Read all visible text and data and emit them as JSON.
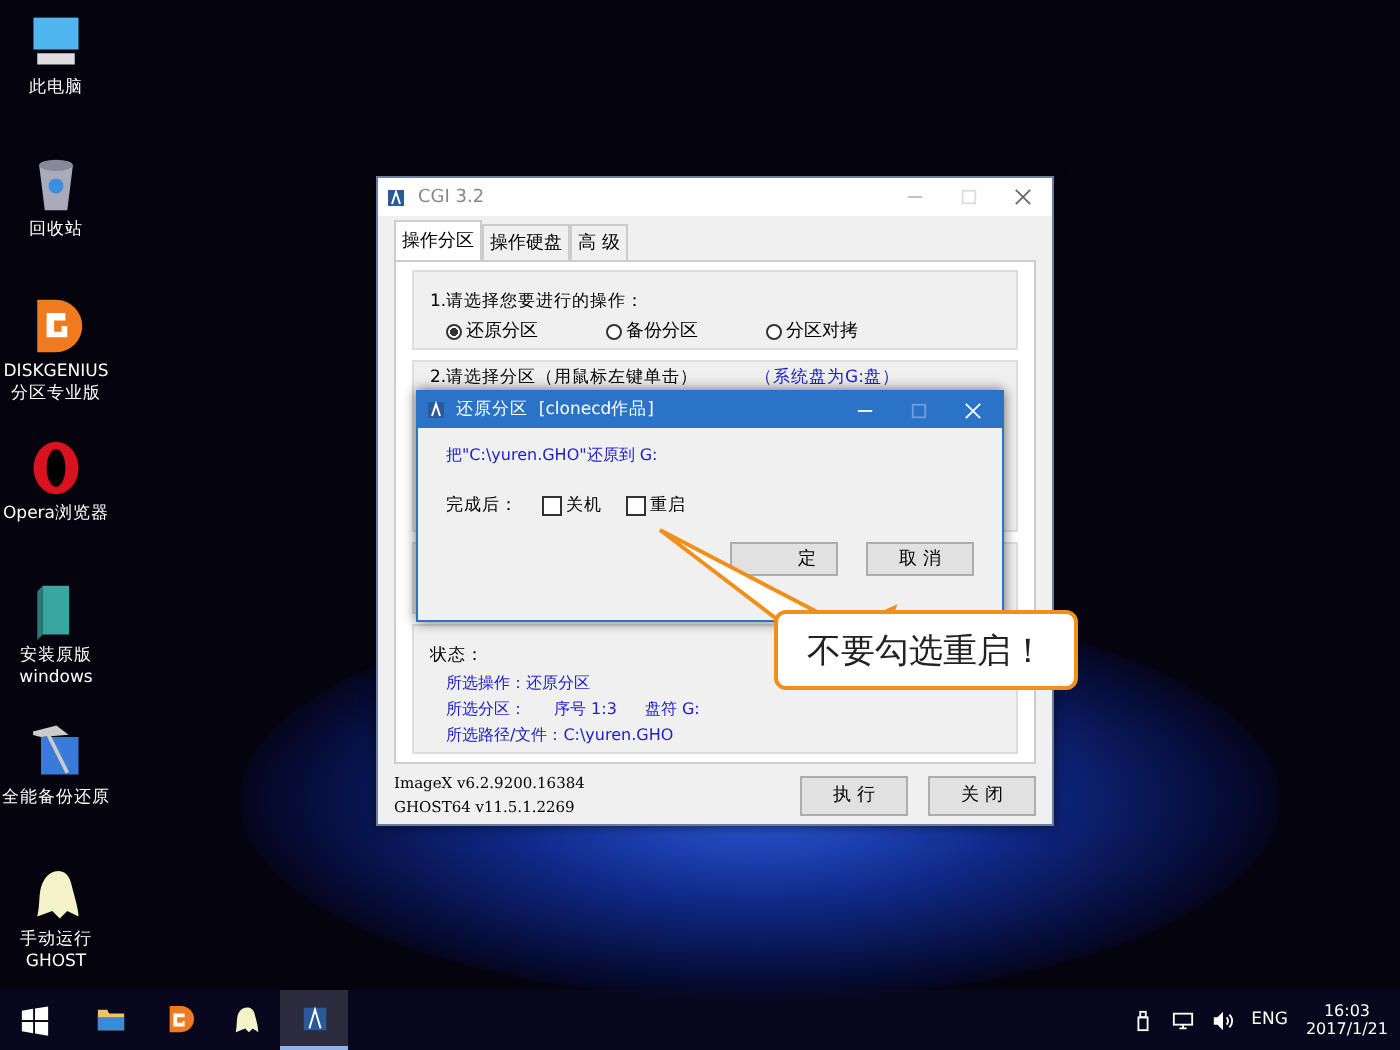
{
  "desktop_icons": [
    {
      "kind": "computer",
      "label": "此电脑"
    },
    {
      "kind": "recycle",
      "label": "回收站"
    },
    {
      "kind": "diskgenius",
      "label": "DISKGENIUS 分区专业版"
    },
    {
      "kind": "opera",
      "label": "Opera浏览器"
    },
    {
      "kind": "install",
      "label": "安装原版 windows"
    },
    {
      "kind": "backup",
      "label": "全能备份还原"
    },
    {
      "kind": "ghost",
      "label": "手动运行 GHOST"
    }
  ],
  "main_window": {
    "title": "CGI 3.2",
    "tabs": [
      {
        "label": "操作分区",
        "selected": true
      },
      {
        "label": "操作硬盘",
        "selected": false
      },
      {
        "label": "高 级",
        "selected": false
      }
    ],
    "step1": {
      "label": "1.请选择您要进行的操作：",
      "options": [
        {
          "label": "还原分区",
          "selected": true
        },
        {
          "label": "备份分区",
          "selected": false
        },
        {
          "label": "分区对拷",
          "selected": false
        }
      ]
    },
    "step2": {
      "label": "2.请选择分区（用鼠标左键单击）",
      "note": "（系统盘为G:盘）"
    },
    "status": {
      "heading": "状态：",
      "lines": [
        [
          "所选操作：还原分区"
        ],
        [
          "所选分区：",
          "序号 1:3",
          "盘符 G:"
        ],
        [
          "所选路径/文件：C:\\yuren.GHO"
        ]
      ]
    },
    "versions": [
      "ImageX v6.2.9200.16384",
      "GHOST64 v11.5.1.2269"
    ],
    "buttons": [
      "执 行",
      "关 闭"
    ]
  },
  "dialog": {
    "title": "还原分区  [clonecd作品]",
    "message": "把\"C:\\yuren.GHO\"还原到 G:",
    "after_label": "完成后：",
    "checkboxes": [
      {
        "label": "关机",
        "checked": false
      },
      {
        "label": "重启",
        "checked": false
      }
    ],
    "buttons": [
      "定",
      "取 消"
    ]
  },
  "callout": {
    "text": "不要勾选重启！"
  },
  "taskbar": {
    "apps": [
      {
        "kind": "folder",
        "active": false
      },
      {
        "kind": "diskgenius",
        "active": false
      },
      {
        "kind": "ghost",
        "active": false
      },
      {
        "kind": "cgi",
        "active": true
      }
    ],
    "language": "ENG",
    "time": "16:03",
    "date": "2017/1/21"
  }
}
